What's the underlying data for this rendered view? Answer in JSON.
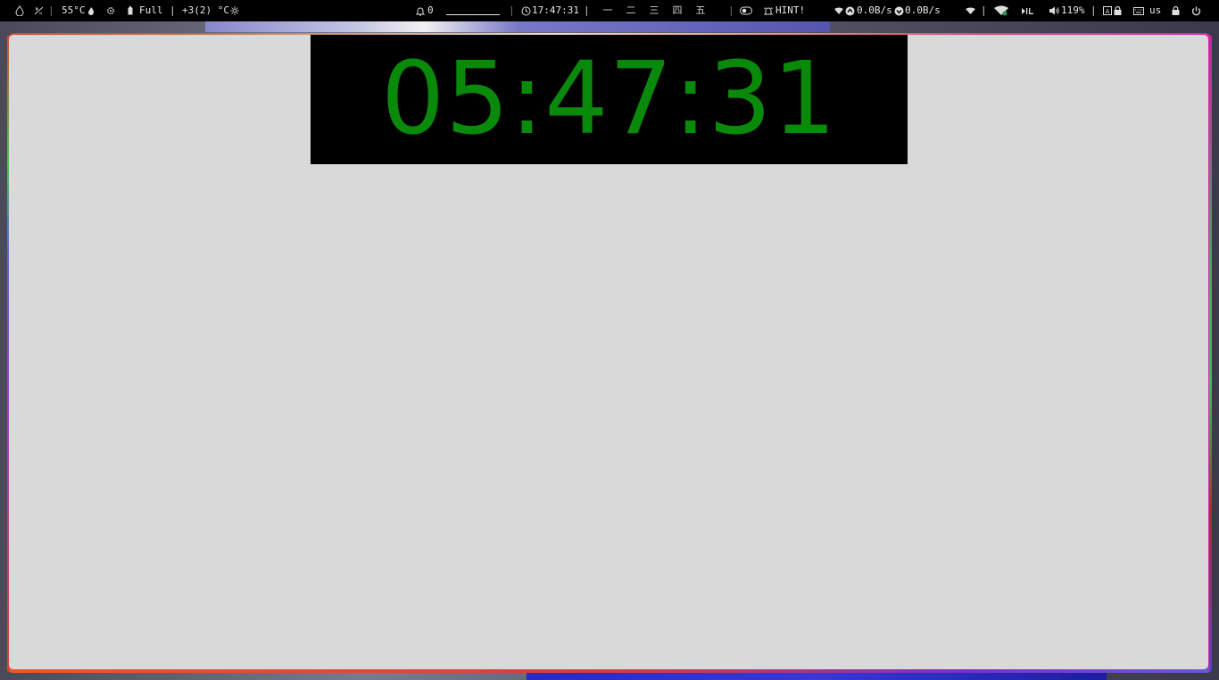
{
  "topbar": {
    "left": {
      "temp_cpu": "55°C",
      "battery": "Full",
      "weather": "+3(2) °C"
    },
    "center": {
      "notifications_count": "0",
      "clock": "17:47:31",
      "workspaces": [
        "一",
        "二",
        "三",
        "四",
        "五"
      ],
      "hint": "HINT!"
    },
    "right": {
      "net_up": "0.0B/s",
      "net_down": "0.0B/s",
      "volume": "119%",
      "keyboard_layout": "us"
    },
    "icons": [
      "drop-icon",
      "slash-icon",
      "flame-icon",
      "gear-icon",
      "battery-icon",
      "sun-icon",
      "bell-icon",
      "clock-icon",
      "toggle-icon",
      "alarm-icon",
      "wifi-icon",
      "upload-icon",
      "download-icon",
      "signal-icon",
      "network-icon",
      "media-icon",
      "volume-icon",
      "caps-icon",
      "lock-icon",
      "keyboard-icon",
      "screen-lock-icon",
      "power-icon"
    ]
  },
  "window": {
    "clock_display": "05:47:31 PM"
  },
  "colors": {
    "clock_text": "#0a8a0a",
    "clock_bg": "#000000",
    "window_bg": "#d9d9d9",
    "topbar_bg": "#000000"
  }
}
